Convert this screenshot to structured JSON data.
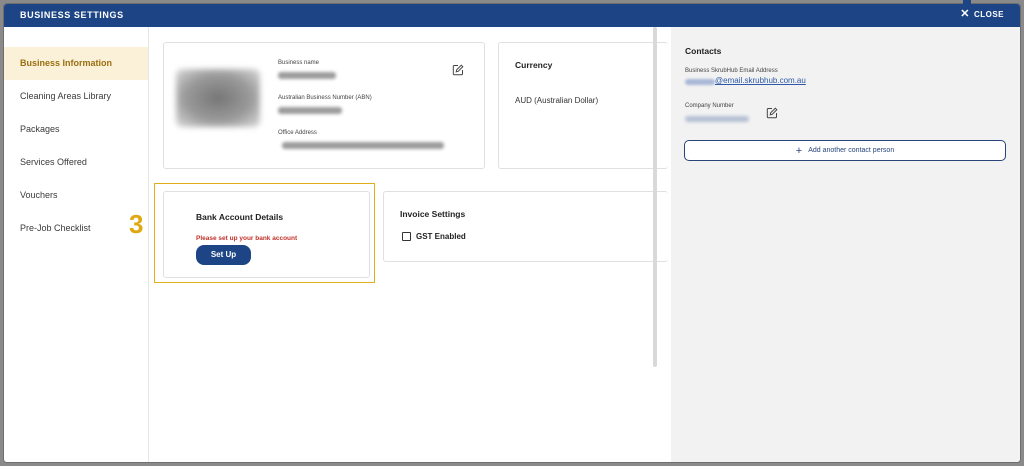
{
  "header": {
    "title": "BUSINESS SETTINGS",
    "close_label": "CLOSE"
  },
  "sidebar": {
    "items": [
      {
        "label": "Business Information",
        "active": true
      },
      {
        "label": "Cleaning Areas Library",
        "active": false
      },
      {
        "label": "Packages",
        "active": false
      },
      {
        "label": "Services Offered",
        "active": false
      },
      {
        "label": "Vouchers",
        "active": false
      },
      {
        "label": "Pre-Job Checklist",
        "active": false
      }
    ]
  },
  "step_marker": "3",
  "business_card": {
    "business_name_label": "Business name",
    "abn_label": "Australian Business Number (ABN)",
    "office_address_label": "Office Address"
  },
  "currency_card": {
    "title": "Currency",
    "value": "AUD (Australian Dollar)"
  },
  "bank_card": {
    "title": "Bank Account Details",
    "error": "Please set up your bank account",
    "setup_label": "Set Up"
  },
  "invoice_card": {
    "title": "Invoice Settings",
    "gst_label": "GST Enabled",
    "gst_checked": false
  },
  "contacts": {
    "title": "Contacts",
    "email_label": "Business SkrubHub Email Address",
    "email_visible": "@email.skrubhub.com.au",
    "company_number_label": "Company Number",
    "add_contact_label": "Add another contact person"
  },
  "colors": {
    "brand": "#1d4585",
    "highlight": "#e0ae18",
    "active_nav_bg": "#fbf1d9",
    "error": "#c0302a"
  }
}
